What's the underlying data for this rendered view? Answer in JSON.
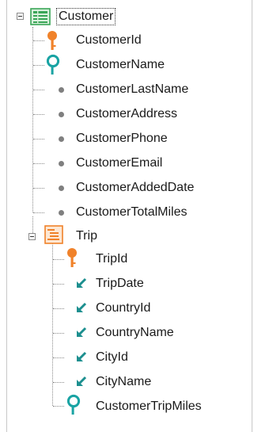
{
  "tree": {
    "customer": {
      "label": "Customer",
      "icon": "transaction-table-icon",
      "attributes": [
        {
          "label": "CustomerId",
          "icon": "key-icon"
        },
        {
          "label": "CustomerName",
          "icon": "search-icon"
        },
        {
          "label": "CustomerLastName",
          "icon": "bullet-icon"
        },
        {
          "label": "CustomerAddress",
          "icon": "bullet-icon"
        },
        {
          "label": "CustomerPhone",
          "icon": "bullet-icon"
        },
        {
          "label": "CustomerEmail",
          "icon": "bullet-icon"
        },
        {
          "label": "CustomerAddedDate",
          "icon": "bullet-icon"
        },
        {
          "label": "CustomerTotalMiles",
          "icon": "bullet-icon"
        }
      ],
      "trip": {
        "label": "Trip",
        "icon": "level-icon",
        "attributes": [
          {
            "label": "TripId",
            "icon": "key-icon"
          },
          {
            "label": "TripDate",
            "icon": "inferred-arrow-icon"
          },
          {
            "label": "CountryId",
            "icon": "inferred-arrow-icon"
          },
          {
            "label": "CountryName",
            "icon": "inferred-arrow-icon"
          },
          {
            "label": "CityId",
            "icon": "inferred-arrow-icon"
          },
          {
            "label": "CityName",
            "icon": "inferred-arrow-icon"
          },
          {
            "label": "CustomerTripMiles",
            "icon": "search-icon"
          }
        ]
      }
    }
  },
  "colors": {
    "key": "#f0822a",
    "search": "#19a3a3",
    "arrow": "#1c8f8f",
    "bullet": "#7f7f7f",
    "transaction": "#3aa657",
    "level": "#f0822a"
  }
}
